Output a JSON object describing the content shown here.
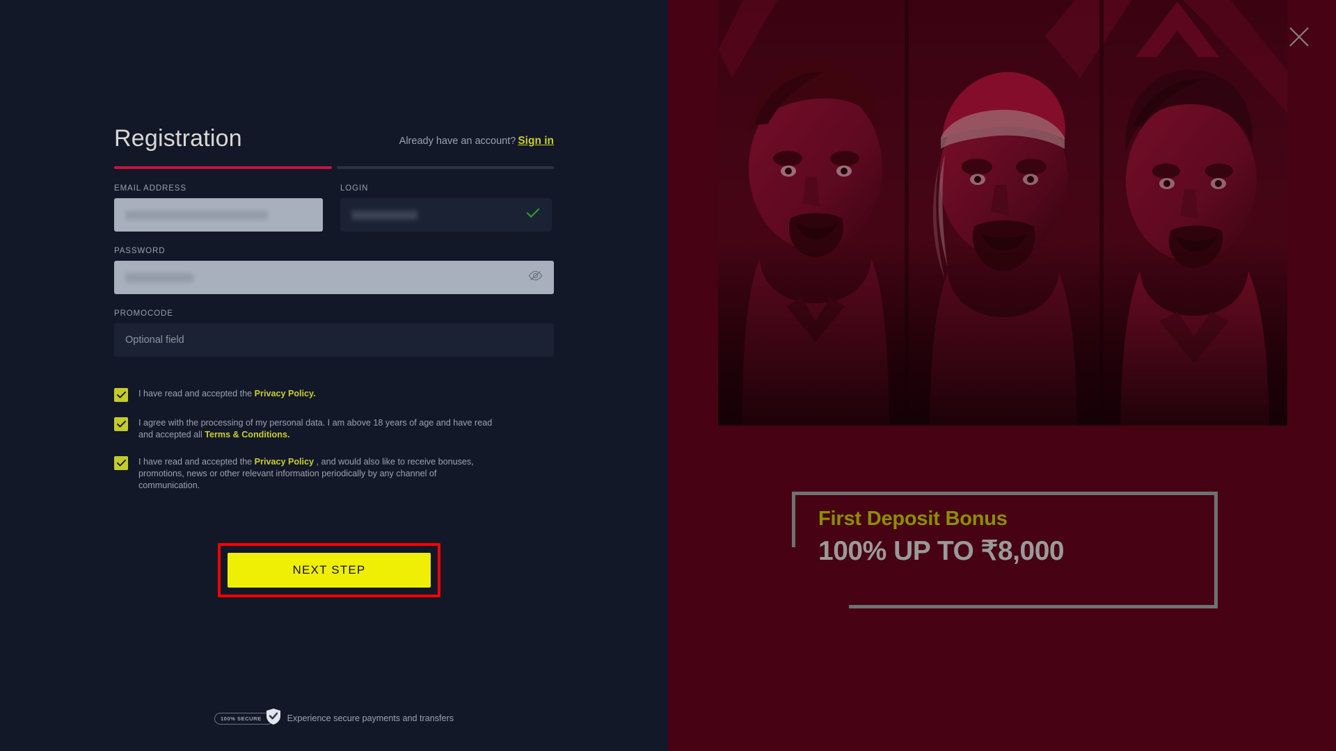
{
  "window": {
    "close_icon": "close-x-icon"
  },
  "form": {
    "title": "Registration",
    "signin_prompt": "Already have an account?",
    "signin_link": "Sign in",
    "progress": {
      "total_steps": 2,
      "active_steps": 1
    },
    "fields": {
      "email": {
        "label": "EMAIL ADDRESS",
        "value": "",
        "redacted": true,
        "placeholder": ""
      },
      "login": {
        "label": "LOGIN",
        "value": "",
        "redacted": true,
        "placeholder": "",
        "valid_icon": "green-check-icon"
      },
      "password": {
        "label": "PASSWORD",
        "value": "",
        "redacted": true,
        "placeholder": "",
        "toggle_icon": "eye-off-icon"
      },
      "promocode": {
        "label": "PROMOCODE",
        "value": "",
        "placeholder": "Optional field"
      }
    },
    "consents": [
      {
        "checked": true,
        "parts": [
          {
            "text": "I have read and accepted the ",
            "link": false
          },
          {
            "text": "Privacy Policy.",
            "link": true
          }
        ]
      },
      {
        "checked": true,
        "parts": [
          {
            "text": "I agree with the processing of my personal data. I am above 18 years of age and have read and accepted all ",
            "link": false
          },
          {
            "text": "Terms & Conditions.",
            "link": true
          }
        ]
      },
      {
        "checked": true,
        "parts": [
          {
            "text": "I have read and accepted the ",
            "link": false
          },
          {
            "text": "Privacy Policy",
            "link": true
          },
          {
            "text": " , and would also like to receive bonuses, promotions, news or other relevant information periodically by any channel of communication.",
            "link": false
          }
        ]
      }
    ],
    "submit_label": "NEXT STEP",
    "footer": {
      "badge_text": "100% SECURE",
      "badge_icon": "shield-check-icon",
      "text": "Experience secure payments and transfers"
    }
  },
  "promo": {
    "hero_alt": "three-cricket-players-illustration",
    "bonus_title": "First Deposit Bonus",
    "bonus_amount": "100% UP TO ₹8,000"
  },
  "colors": {
    "panel_bg": "#131828",
    "promo_bg": "#470313",
    "accent_yellow": "#c8cf2f",
    "button_yellow": "#efef05",
    "highlight_red": "#ff0000",
    "progress_active": "#c6123f",
    "valid_green": "#2f9e2f",
    "bonus_title": "#8b8f05",
    "bonus_amount": "#9a9a9a"
  }
}
